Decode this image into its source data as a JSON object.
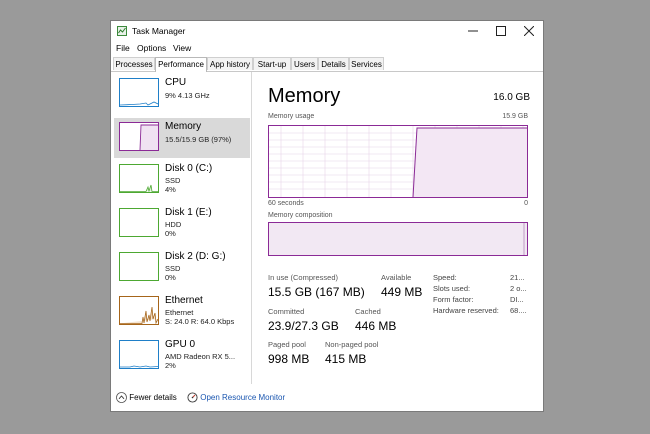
{
  "window": {
    "title": "Task Manager"
  },
  "menu": [
    "File",
    "Options",
    "View"
  ],
  "tabs": [
    "Processes",
    "Performance",
    "App history",
    "Start-up",
    "Users",
    "Details",
    "Services"
  ],
  "active_tab": "Performance",
  "sidebar": {
    "items": [
      {
        "name": "CPU",
        "line1": "9%  4.13 GHz",
        "line2": ""
      },
      {
        "name": "Memory",
        "line1": "15.5/15.9 GB (97%)",
        "line2": ""
      },
      {
        "name": "Disk 0 (C:)",
        "line1": "SSD",
        "line2": "4%"
      },
      {
        "name": "Disk 1 (E:)",
        "line1": "HDD",
        "line2": "0%"
      },
      {
        "name": "Disk 2 (D: G:)",
        "line1": "SSD",
        "line2": "0%"
      },
      {
        "name": "Ethernet",
        "line1": "Ethernet",
        "line2": "S: 24.0  R: 64.0 Kbps"
      },
      {
        "name": "GPU 0",
        "line1": "AMD Radeon RX 5...",
        "line2": "2%"
      }
    ],
    "selected": "Memory"
  },
  "main": {
    "title": "Memory",
    "total": "16.0 GB",
    "usage_label": "Memory usage",
    "usage_max": "15.9 GB",
    "time_label": "60 seconds",
    "time_min": "0",
    "composition_label": "Memory composition",
    "stats": {
      "in_use_label": "In use (Compressed)",
      "in_use_value": "15.5 GB (167 MB)",
      "available_label": "Available",
      "available_value": "449 MB",
      "committed_label": "Committed",
      "committed_value": "23.9/27.3 GB",
      "cached_label": "Cached",
      "cached_value": "446 MB",
      "paged_label": "Paged pool",
      "paged_value": "998 MB",
      "nonpaged_label": "Non-paged pool",
      "nonpaged_value": "415 MB"
    },
    "details": [
      {
        "label": "Speed:",
        "value": "21..."
      },
      {
        "label": "Slots used:",
        "value": "2 o..."
      },
      {
        "label": "Form factor:",
        "value": "DI..."
      },
      {
        "label": "Hardware reserved:",
        "value": "68...."
      }
    ]
  },
  "footer": {
    "fewer_details": "Fewer details",
    "resource_monitor": "Open Resource Monitor"
  },
  "colors": {
    "memory_accent": "#8b2a96",
    "cpu": "#1f7fc8",
    "disk": "#4da832",
    "ethernet": "#a6651a",
    "gpu": "#1f7fc8",
    "link": "#1a56b0"
  }
}
